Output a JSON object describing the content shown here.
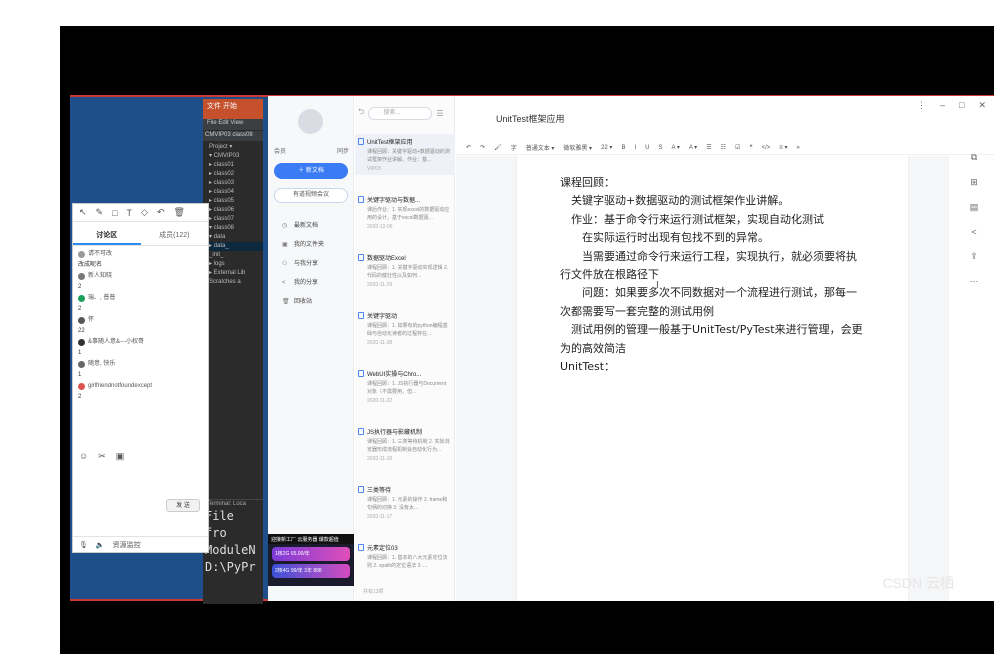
{
  "pycharm": {
    "wps_tab": "文件",
    "wps_tab2": "开始",
    "menu": "File  Edit  View",
    "path": "CMVIP03  class08",
    "tree": [
      "Project ▾",
      "▾ CMVIP03",
      "▸ class01",
      "▸ class02",
      "▸ class03",
      "▸ class04",
      "▸ class05",
      "▸ class06",
      "▸ class07",
      "▾ class08",
      "▾ data",
      "▸ data_",
      "_init_",
      "▸ logs",
      "▸ External Lib",
      "Scratches a"
    ],
    "terminal_tabs": "Terminal:  Loca",
    "terminal_lines": [
      "  File",
      "    fro",
      "ModuleN",
      "D:\\PyPr"
    ]
  },
  "chat": {
    "tools": [
      "↖",
      "✎",
      "□",
      "T",
      "◇",
      "↶",
      "🗑"
    ],
    "tab_discussion": "讨论区",
    "tab_members": "成员(122)",
    "messages": [
      {
        "who": "请不可改",
        "text": "改成昵名"
      },
      {
        "who": "新人知晓",
        "text": "2"
      },
      {
        "who": "瑞、, 普普",
        "text": "2"
      },
      {
        "who": "怀",
        "text": "22"
      },
      {
        "who": "&事随人意&---小权哥",
        "text": "1"
      },
      {
        "who": "随意, 快乐",
        "text": "1"
      },
      {
        "who": "girlfriendnotfoundexcept",
        "text": "2"
      }
    ],
    "send_label": "发 送",
    "bottom_label": "资源监控"
  },
  "notes": {
    "sidebar": {
      "vip": "会员",
      "sync": "同步",
      "new_doc": "新文档",
      "meeting": "有道视频会议",
      "nav": [
        "最新文档",
        "我的文件夹",
        "与我分享",
        "我的分享",
        "回收站"
      ]
    },
    "promo": {
      "header": "迎接新工厂 云服务器 爆款超值",
      "line1": "1核2G 65.00/年",
      "line2": "2核4G 99/年 3年 888"
    },
    "list": {
      "search_placeholder": "搜索...",
      "items": [
        {
          "title": "UnitTest框架应用",
          "desc": "课程回顾：关键字驱动+数据驱动的测试框架作业讲解。作业：基...",
          "date": "VIP03"
        },
        {
          "title": "关键字驱动与数据...",
          "desc": "课后作业：1. 实现excel的数据驱动应用的设计，基于excel数据驱...",
          "date": "2020-12-06"
        },
        {
          "title": "数据驱动Excel",
          "desc": "课程回顾：1. 关键字驱动实现逻辑 2. 代码的健壮性以及如何...",
          "date": "2020-11-29"
        },
        {
          "title": "关键字驱动",
          "desc": "课程回顾：1. 如果有的python编程基础与自动化读者的过程存在...",
          "date": "2020-11-28"
        },
        {
          "title": "WebUI实操与Chro...",
          "desc": "课程回顾：1. JS执行器与Document对象（不需要用，但...",
          "date": "2020-11-22"
        },
        {
          "title": "JS执行器与影藏机制",
          "desc": "课程回顾：1. 三类等待机制 2. 实际浏览器形成流程机制会自动化行为...",
          "date": "2020-11-19"
        },
        {
          "title": "三类等待",
          "desc": "课程回顾：1. 元素的操作 2. frame和句柄的切换 3. 没有太...",
          "date": "2020-11-17"
        },
        {
          "title": "元素定位03",
          "desc": "课程回顾：1. 基本的八大元素定位法则 2. xpath的定位语法 3. ...",
          "date": ""
        }
      ],
      "footer": "共有13项"
    },
    "editor": {
      "title": "UnitTest框架应用",
      "toolbar": [
        "↶",
        "↷",
        "🖌",
        "字",
        "普通文本 ▾",
        "微软雅黑 ▾",
        "22 ▾",
        "B",
        "I",
        "U",
        "S",
        "A ▾",
        "A ▾",
        "☰",
        "☷",
        "☑",
        "❝",
        "</>",
        "≡ ▾",
        "»"
      ],
      "paragraphs": [
        "课程回顾：",
        "　关键字驱动+数据驱动的测试框架作业讲解。",
        "　作业：基于命令行来运行测试框架，实现自动化测试",
        "　　在实际运行时出现有包找不到的异常。",
        "　　当需要通过命令行来运行工程，实现执行，就必须要将执行文件放在根路径下",
        "　　问题：如果要多次不同数据对一个流程进行测试，那每一次都需要写一套完整的测试用例",
        "　测试用例的管理一般基于UnitTest/PyTest来进行管理，会更为的高效简洁",
        "UnitTest："
      ],
      "right_icons": [
        "copy-icon",
        "plus-box-icon",
        "doc-icon",
        "share-icon",
        "export-icon",
        "more-icon"
      ],
      "watermark": "CSDN 云栖"
    }
  },
  "colors": {
    "desktop": "#1e4f8a",
    "accent": "#3b7cf5",
    "wps": "#c4512c",
    "red_line": "#c93a2f"
  }
}
